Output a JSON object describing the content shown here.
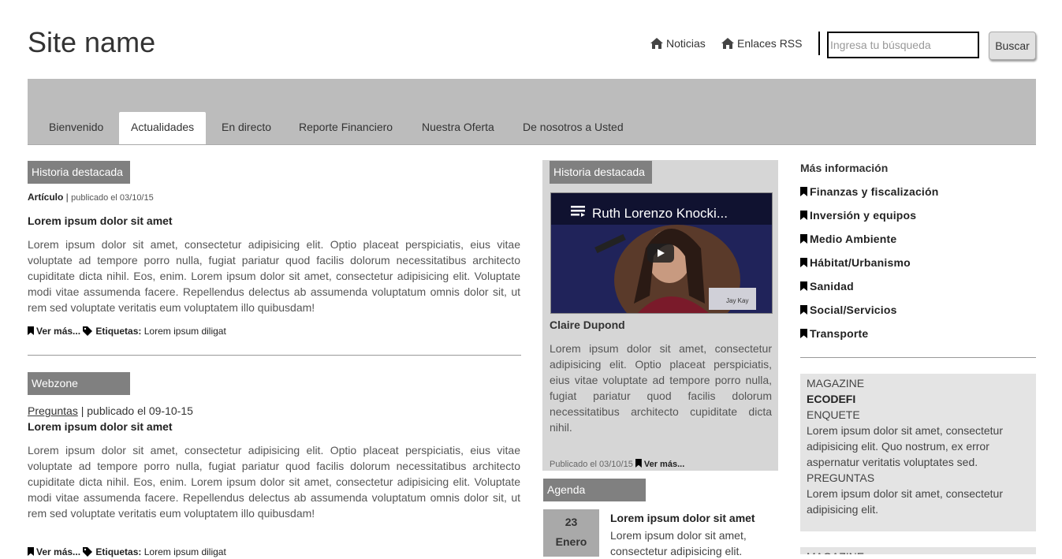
{
  "header": {
    "site_name": "Site name",
    "links": [
      "Noticias",
      "Enlaces RSS"
    ],
    "search_placeholder": "Ingresa tu búsqueda",
    "search_button": "Buscar"
  },
  "nav": {
    "tabs": [
      "Bienvenido",
      "Actualidades",
      "En directo",
      "Reporte Financiero",
      "Nuestra Oferta",
      "De nosotros a Usted"
    ],
    "active_tab": "Actualidades"
  },
  "left": {
    "featured": {
      "badge": "Historia destacada",
      "type": "Artículo",
      "sep": " | ",
      "published": "publicado el 03/10/15",
      "title": "Lorem ipsum dolor sit amet",
      "body": "Lorem ipsum dolor sit amet, consectetur adipisicing elit. Optio placeat perspiciatis, eius vitae voluptate ad tempore porro nulla, fugiat pariatur quod facilis dolorum necessitatibus architecto cupiditate dicta nihil. Eos, enim. Lorem ipsum dolor sit amet, consectetur adipisicing elit. Voluptate modi vitae assumenda facere. Repellendus delectus ab assumenda voluptatum omnis dolor sit, ut rem sed voluptate veritatis eum voluptatem illo quibusdam!",
      "more": "Ver más...",
      "tags_label": "Etiquetas:",
      "tags": "Lorem ipsum diligat"
    },
    "webzone": {
      "badge": "Webzone",
      "category": "Preguntas",
      "published": " | publicado el 09-10-15",
      "title": "Lorem ipsum dolor sit amet",
      "body": "Lorem ipsum dolor sit amet, consectetur adipisicing elit. Optio placeat perspiciatis, eius vitae voluptate ad tempore porro nulla, fugiat pariatur quod facilis dolorum necessitatibus architecto cupiditate dicta nihil. Eos, enim. Lorem ipsum dolor sit amet, consectetur adipisicing elit. Voluptate modi vitae assumenda facere. Repellendus delectus ab assumenda voluptatum omnis dolor sit, ut rem sed voluptate veritatis eum voluptatem illo quibusdam!",
      "more": "Ver más...",
      "tags_label": "Etiquetas:",
      "tags": "Lorem ipsum diligat"
    }
  },
  "middle": {
    "featured": {
      "badge": "Historia destacada",
      "video_title": "Ruth Lorenzo Knocki...",
      "video_caption": "Jay Kay",
      "author": "Claire Dupond",
      "body": "Lorem ipsum dolor sit amet, consectetur adipisicing elit. Optio placeat perspiciatis, eius vitae voluptate ad tempore porro nulla, fugiat pariatur quod facilis dolorum necessitatibus architecto cupiditate dicta nihil.",
      "published": "Publicado el 03/10/15",
      "more": "Ver más..."
    },
    "agenda": {
      "badge": "Agenda",
      "day": "23",
      "month": "Enero",
      "title": "Lorem ipsum dolor sit amet",
      "body": "Lorem ipsum dolor sit amet, consectetur adipisicing elit."
    }
  },
  "right": {
    "heading": "Más información",
    "items": [
      "Finanzas y fiscalización",
      "Inversión y equipos",
      "Medio Ambiente",
      "Hábitat/Urbanismo",
      "Sanidad",
      "Social/Servicios",
      "Transporte"
    ],
    "magazine": {
      "label": "MAGAZINE",
      "name": "ECODEFI",
      "section1": "ENQUETE",
      "text1": "Lorem ipsum dolor sit amet, consectetur adipisicing elit. Quo nostrum, ex error aspernatur veritatis voluptates sed.",
      "section2": "PREGUNTAS",
      "text2": "Lorem ipsum dolor sit amet, consectetur adipisicing elit."
    },
    "magazine2_label": "MAGAZINE"
  }
}
